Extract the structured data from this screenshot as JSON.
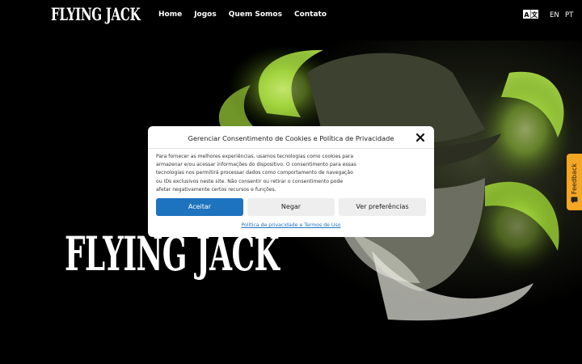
{
  "header": {
    "logo_text": "FLYING JACK",
    "nav": [
      {
        "label": "Home"
      },
      {
        "label": "Jogos"
      },
      {
        "label": "Quem Somos"
      },
      {
        "label": "Contato"
      }
    ],
    "languages": [
      "EN",
      "PT"
    ]
  },
  "hero": {
    "title": "FLYING JACK"
  },
  "cookie_modal": {
    "title": "Gerenciar Consentimento de Cookies e Política de Privacidade",
    "body": "Para fornecer as melhores experiências, usamos tecnologias como cookies para armazenar e/ou acessar informações do dispositivo. O consentimento para essas tecnologias nos permitirá processar dados como comportamento de navegação ou IDs exclusivos neste site. Não consentir ou retirar o consentimento pode afetar negativamente certos recursos e funções.",
    "accept_label": "Aceitar",
    "deny_label": "Negar",
    "prefs_label": "Ver preferências",
    "privacy_link": "Política de privacidade",
    "links_separator": " e ",
    "terms_link": "Termos de Uso"
  },
  "feedback": {
    "label": "Feedback"
  },
  "colors": {
    "accent": "#1e73be",
    "glow": "#a8e03a",
    "feedback": "#f5a623"
  },
  "icons": {
    "translate": "translate-icon",
    "close": "close-icon",
    "feedback": "feedback-icon"
  }
}
